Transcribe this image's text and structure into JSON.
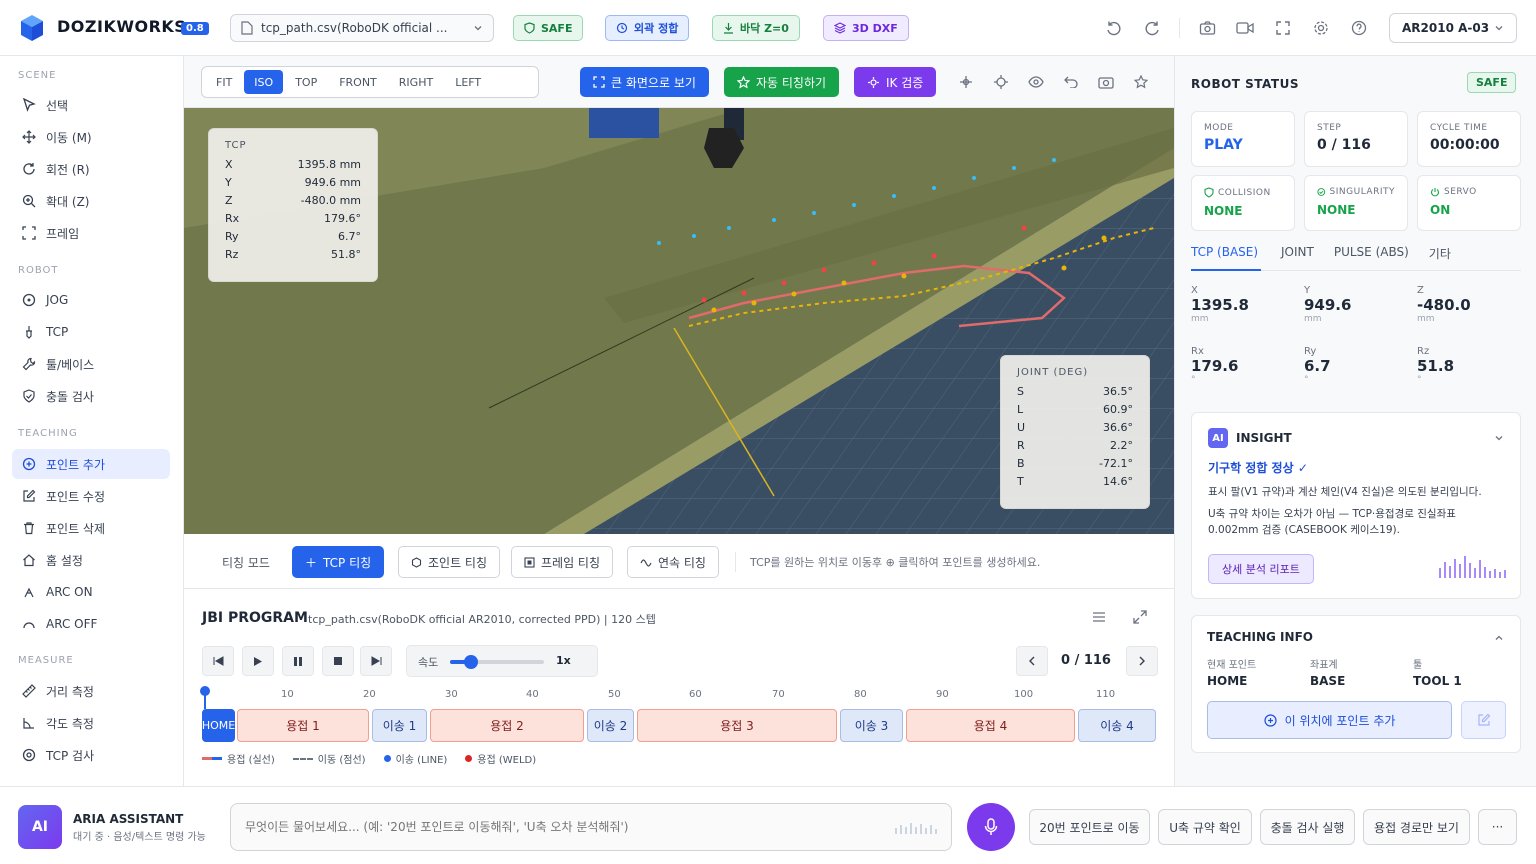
{
  "app": {
    "name": "DOZIKWORKS",
    "version": "0.8"
  },
  "topbar": {
    "file": "tcp_path.csv(RoboDK official ...",
    "safe": "SAFE",
    "ext_align": "외곽 정합",
    "floor": "바닥 Z=0",
    "dxf": "3D DXF",
    "robot": "AR2010 A-03"
  },
  "sidebar": {
    "scene_title": "SCENE",
    "scene": [
      "선택",
      "이동 (M)",
      "회전 (R)",
      "확대 (Z)",
      "프레임"
    ],
    "robot_title": "ROBOT",
    "robot": [
      "JOG",
      "TCP",
      "툴/베이스",
      "충돌 검사"
    ],
    "teaching_title": "TEACHING",
    "teaching": [
      "포인트 추가",
      "포인트 수정",
      "포인트 삭제",
      "홈 설정",
      "ARC ON",
      "ARC OFF"
    ],
    "measure_title": "MEASURE",
    "measure": [
      "거리 측정",
      "각도 측정",
      "TCP 검사"
    ]
  },
  "viewbar": {
    "views": [
      "FIT",
      "ISO",
      "TOP",
      "FRONT",
      "RIGHT",
      "LEFT"
    ],
    "active_view": "ISO",
    "fullscreen": "큰 화면으로 보기",
    "auto_teach": "자동 티칭하기",
    "ik": "IK 검증"
  },
  "tcp_overlay": {
    "title": "TCP",
    "rows": [
      {
        "k": "X",
        "v": "1395.8 mm"
      },
      {
        "k": "Y",
        "v": "949.6 mm"
      },
      {
        "k": "Z",
        "v": "-480.0 mm"
      },
      {
        "k": "Rx",
        "v": "179.6°"
      },
      {
        "k": "Ry",
        "v": "6.7°"
      },
      {
        "k": "Rz",
        "v": "51.8°"
      }
    ]
  },
  "joint_overlay": {
    "title": "JOINT (DEG)",
    "rows": [
      {
        "k": "S",
        "v": "36.5°"
      },
      {
        "k": "L",
        "v": "60.9°"
      },
      {
        "k": "U",
        "v": "36.6°"
      },
      {
        "k": "R",
        "v": "2.2°"
      },
      {
        "k": "B",
        "v": "-72.1°"
      },
      {
        "k": "T",
        "v": "14.6°"
      }
    ]
  },
  "teachbar": {
    "mode_label": "티칭 모드",
    "tcp": "TCP 티칭",
    "joint": "조인트 티칭",
    "frame": "프레임 티칭",
    "cont": "연속 티칭",
    "hint": "TCP를 원하는 위치로 이동후 ⊕ 클릭하여 포인트를 생성하세요."
  },
  "program": {
    "title": "JBI PROGRAM",
    "sub": "tcp_path.csv(RoboDK official AR2010, corrected PPD) | 120 스텝",
    "speed_label": "속도",
    "speed_value": "1x",
    "speed_fraction": 0.22,
    "step": "0 / 116",
    "ticks": [
      "10",
      "20",
      "30",
      "40",
      "50",
      "60",
      "70",
      "80",
      "90",
      "100",
      "110"
    ],
    "segments": [
      {
        "label": "HOME",
        "type": "home"
      },
      {
        "label": "용접 1",
        "type": "weld"
      },
      {
        "label": "이송 1",
        "type": "move"
      },
      {
        "label": "용접 2",
        "type": "weld"
      },
      {
        "label": "이송 2",
        "type": "move"
      },
      {
        "label": "용접 3",
        "type": "weld"
      },
      {
        "label": "이송 3",
        "type": "move"
      },
      {
        "label": "용접 4",
        "type": "weld"
      },
      {
        "label": "이송 4",
        "type": "move"
      }
    ],
    "legend": [
      "용접 (실선)",
      "이동 (점선)",
      "이송 (LINE)",
      "용접 (WELD)"
    ]
  },
  "status": {
    "title": "ROBOT STATUS",
    "badge": "SAFE",
    "mode_label": "MODE",
    "mode": "PLAY",
    "step_label": "STEP",
    "step": "0 / 116",
    "cycle_label": "CYCLE TIME",
    "cycle": "00:00:00",
    "collision_label": "COLLISION",
    "collision": "NONE",
    "singularity_label": "SINGULARITY",
    "singularity": "NONE",
    "servo_label": "SERVO",
    "servo": "ON",
    "tabs": [
      "TCP (BASE)",
      "JOINT",
      "PULSE (ABS)",
      "기타"
    ],
    "coords": [
      {
        "k": "X",
        "v": "1395.8",
        "u": "mm"
      },
      {
        "k": "Y",
        "v": "949.6",
        "u": "mm"
      },
      {
        "k": "Z",
        "v": "-480.0",
        "u": "mm"
      },
      {
        "k": "Rx",
        "v": "179.6",
        "u": "°"
      },
      {
        "k": "Ry",
        "v": "6.7",
        "u": "°"
      },
      {
        "k": "Rz",
        "v": "51.8",
        "u": "°"
      }
    ]
  },
  "insight": {
    "badge": "AI",
    "title": "INSIGHT",
    "headline": "기구학 정합 정상 ✓",
    "p1": "표시 팔(V1 규약)과 계산 체인(V4 진실)은 의도된 분리입니다.",
    "p2": "U축 규약 차이는 오차가 아님 — TCP·용접경로 진실좌표 0.002mm 검증 (CASEBOOK 케이스19).",
    "button": "상세 분석 리포트"
  },
  "teachinfo": {
    "title": "TEACHING INFO",
    "cur_label": "현재 포인트",
    "cur": "HOME",
    "coord_label": "좌표계",
    "coord": "BASE",
    "tool_label": "툴",
    "tool": "TOOL 1",
    "add": "이 위치에 포인트 추가"
  },
  "assistant": {
    "badge": "AI",
    "name": "ARIA ASSISTANT",
    "status": "대기 중 · 음성/텍스트 명령 가능",
    "placeholder": "무엇이든 물어보세요... (예: '20번 포인트로 이동해줘', 'U축 오차 분석해줘')",
    "quick": [
      "20번 포인트로 이동",
      "U축 규약 확인",
      "충돌 검사 실행",
      "용접 경로만 보기"
    ],
    "more": "···"
  }
}
